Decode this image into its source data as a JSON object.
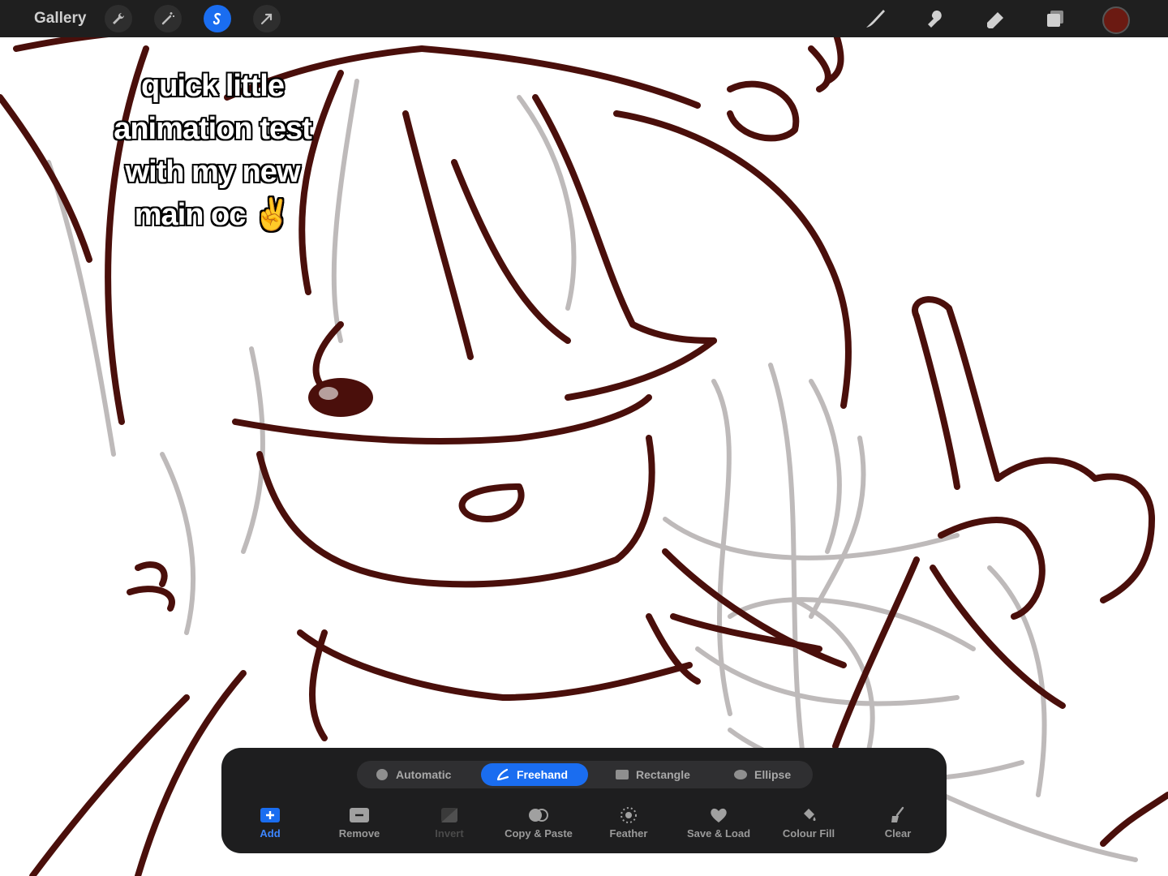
{
  "toolbar": {
    "gallery_label": "Gallery",
    "left_icons": [
      "wrench-icon",
      "magic-wand-icon",
      "selection-icon",
      "transform-arrow-icon"
    ],
    "right_icons": [
      "brush-icon",
      "smudge-icon",
      "eraser-icon",
      "layers-icon"
    ],
    "active_color": "#6b1a12"
  },
  "caption": {
    "line1": "quick little",
    "line2": "animation test",
    "line3": "with my new",
    "line4": "main oc ✌️"
  },
  "selection_panel": {
    "modes": [
      {
        "label": "Automatic",
        "icon": "dot-icon",
        "active": false
      },
      {
        "label": "Freehand",
        "icon": "freehand-icon",
        "active": true
      },
      {
        "label": "Rectangle",
        "icon": "rectangle-icon",
        "active": false
      },
      {
        "label": "Ellipse",
        "icon": "ellipse-icon",
        "active": false
      }
    ],
    "actions": [
      {
        "label": "Add",
        "icon": "add-icon"
      },
      {
        "label": "Remove",
        "icon": "remove-icon"
      },
      {
        "label": "Invert",
        "icon": "invert-icon"
      },
      {
        "label": "Copy & Paste",
        "icon": "copy-paste-icon"
      },
      {
        "label": "Feather",
        "icon": "feather-icon"
      },
      {
        "label": "Save & Load",
        "icon": "heart-icon"
      },
      {
        "label": "Colour Fill",
        "icon": "colour-fill-icon"
      },
      {
        "label": "Clear",
        "icon": "clear-icon"
      }
    ]
  },
  "colors": {
    "accent": "#1a6df0",
    "ink": "#4a0f0b",
    "sketch_grey": "#a09a9a"
  }
}
